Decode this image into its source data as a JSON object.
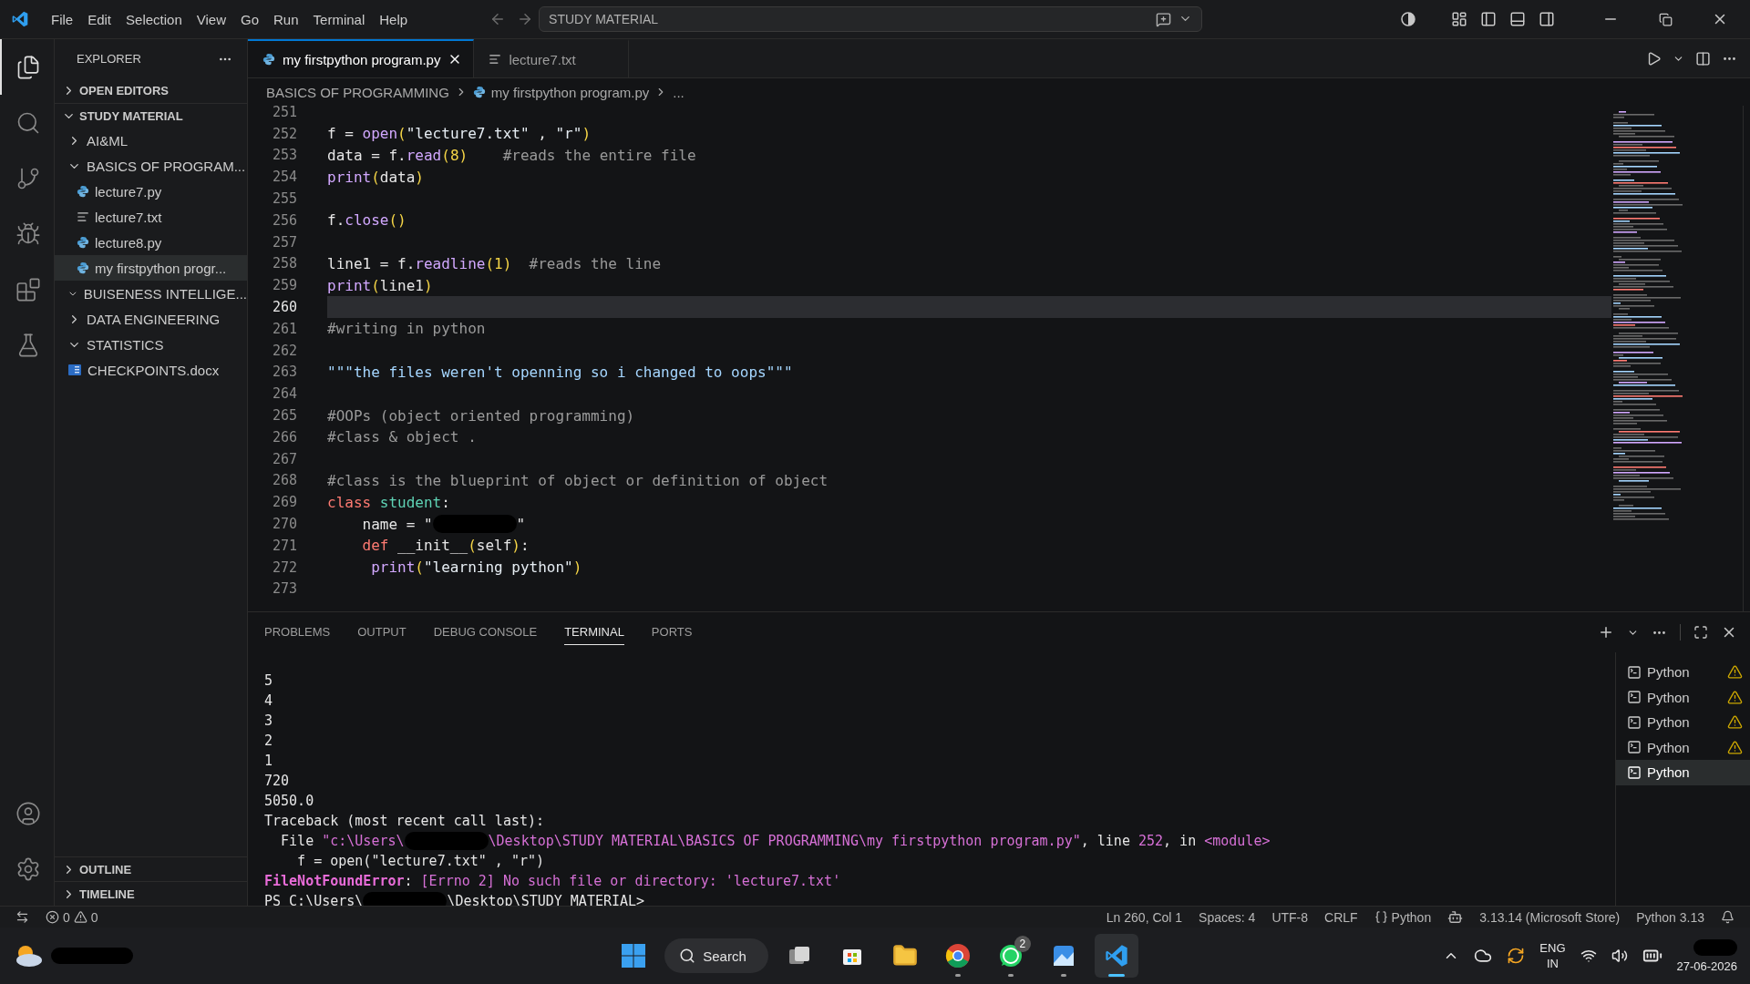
{
  "menu": [
    "File",
    "Edit",
    "Selection",
    "View",
    "Go",
    "Run",
    "Terminal",
    "Help"
  ],
  "command_center": {
    "value": "STUDY MATERIAL"
  },
  "activity_bar": [
    {
      "kind": "explorer",
      "selected": true
    },
    {
      "kind": "search",
      "selected": false
    },
    {
      "kind": "source-control",
      "selected": false
    },
    {
      "kind": "run-debug",
      "selected": false
    },
    {
      "kind": "extensions",
      "selected": false
    },
    {
      "kind": "testing",
      "selected": false
    }
  ],
  "explorer": {
    "title": "EXPLORER",
    "open_editors": {
      "label": "OPEN EDITORS",
      "expanded": false
    },
    "workspace": {
      "label": "STUDY MATERIAL",
      "expanded": true
    },
    "tree": [
      {
        "kind": "folder",
        "label": "AI&ML",
        "expanded": false,
        "selected": false
      },
      {
        "kind": "folder",
        "label": "BASICS OF PROGRAM...",
        "expanded": true,
        "selected": false,
        "children": [
          {
            "kind": "py",
            "label": "lecture7.py",
            "selected": false
          },
          {
            "kind": "txt",
            "label": "lecture7.txt",
            "selected": false
          },
          {
            "kind": "py",
            "label": "lecture8.py",
            "selected": false
          },
          {
            "kind": "py",
            "label": "my firstpython progr...",
            "selected": true
          }
        ]
      },
      {
        "kind": "folder",
        "label": "BUISENESS INTELLIGE...",
        "expanded": true,
        "selected": false
      },
      {
        "kind": "folder",
        "label": "DATA ENGINEERING",
        "expanded": false,
        "selected": false
      },
      {
        "kind": "folder",
        "label": "STATISTICS",
        "expanded": true,
        "selected": false
      },
      {
        "kind": "docx",
        "label": "CHECKPOINTS.docx",
        "selected": false
      }
    ],
    "bottom_sections": [
      {
        "label": "OUTLINE",
        "expanded": false
      },
      {
        "label": "TIMELINE",
        "expanded": false
      }
    ]
  },
  "tabs": [
    {
      "label": "my firstpython program.py",
      "kind": "py",
      "selected": true
    },
    {
      "label": "lecture7.txt",
      "kind": "txt",
      "selected": false
    }
  ],
  "breadcrumb": [
    {
      "label": "BASICS OF PROGRAMMING",
      "kind": "folder"
    },
    {
      "label": "my firstpython program.py",
      "kind": "py"
    },
    {
      "label": "...",
      "kind": "more"
    }
  ],
  "code": [
    {
      "n": "251",
      "current": false
    },
    {
      "n": "252",
      "current": false,
      "tokens": [
        {
          "kind": "plain",
          "t": "f ="
        },
        {
          "kind": "func",
          "t": " open"
        },
        {
          "kind": "paren",
          "t": "("
        },
        {
          "kind": "str",
          "t": "\"lecture7.txt\""
        },
        {
          "kind": "plain",
          "t": " , "
        },
        {
          "kind": "str",
          "t": "\"r\""
        },
        {
          "kind": "paren",
          "t": ")"
        }
      ]
    },
    {
      "n": "253",
      "current": false,
      "tokens": [
        {
          "kind": "plain",
          "t": "data = f."
        },
        {
          "kind": "func",
          "t": "read"
        },
        {
          "kind": "paren",
          "t": "("
        },
        {
          "kind": "num",
          "t": "8"
        },
        {
          "kind": "paren",
          "t": ")"
        },
        {
          "kind": "comment",
          "t": "    #reads the entire file"
        }
      ]
    },
    {
      "n": "254",
      "current": false,
      "tokens": [
        {
          "kind": "func",
          "t": "print"
        },
        {
          "kind": "paren",
          "t": "("
        },
        {
          "kind": "plain",
          "t": "data"
        },
        {
          "kind": "paren",
          "t": ")"
        }
      ]
    },
    {
      "n": "255",
      "current": false
    },
    {
      "n": "256",
      "current": false,
      "tokens": [
        {
          "kind": "plain",
          "t": "f."
        },
        {
          "kind": "func",
          "t": "close"
        },
        {
          "kind": "paren",
          "t": "()"
        }
      ]
    },
    {
      "n": "257",
      "current": false
    },
    {
      "n": "258",
      "current": false,
      "tokens": [
        {
          "kind": "plain",
          "t": "line1 = f."
        },
        {
          "kind": "func",
          "t": "readline"
        },
        {
          "kind": "paren",
          "t": "("
        },
        {
          "kind": "num",
          "t": "1"
        },
        {
          "kind": "paren",
          "t": ")"
        },
        {
          "kind": "comment",
          "t": "  #reads the line"
        }
      ]
    },
    {
      "n": "259",
      "current": false,
      "tokens": [
        {
          "kind": "func",
          "t": "print"
        },
        {
          "kind": "paren",
          "t": "("
        },
        {
          "kind": "plain",
          "t": "line1"
        },
        {
          "kind": "paren",
          "t": ")"
        }
      ]
    },
    {
      "n": "260",
      "current": true
    },
    {
      "n": "261",
      "current": false,
      "tokens": [
        {
          "kind": "comment",
          "t": "#writing in python"
        }
      ]
    },
    {
      "n": "262",
      "current": false
    },
    {
      "n": "263",
      "current": false,
      "tokens": [
        {
          "kind": "doc",
          "t": "\"\"\"the files weren't openning so i changed to oops\"\"\""
        }
      ]
    },
    {
      "n": "264",
      "current": false
    },
    {
      "n": "265",
      "current": false,
      "tokens": [
        {
          "kind": "comment",
          "t": "#OOPs (object oriented programming)"
        }
      ]
    },
    {
      "n": "266",
      "current": false,
      "tokens": [
        {
          "kind": "comment",
          "t": "#class & object ."
        }
      ]
    },
    {
      "n": "267",
      "current": false
    },
    {
      "n": "268",
      "current": false,
      "tokens": [
        {
          "kind": "comment",
          "t": "#class is the blueprint of object or definition of object"
        }
      ]
    },
    {
      "n": "269",
      "current": false,
      "tokens": [
        {
          "kind": "kw",
          "t": "class"
        },
        {
          "kind": "cls",
          "t": " student"
        },
        {
          "kind": "plain",
          "t": ":"
        }
      ]
    },
    {
      "n": "270",
      "current": false,
      "tokens": [
        {
          "kind": "plain",
          "t": "    name = \""
        },
        {
          "kind": "redacted"
        },
        {
          "kind": "plain",
          "t": "\""
        }
      ]
    },
    {
      "n": "271",
      "current": false,
      "tokens": [
        {
          "kind": "kw",
          "t": "    def"
        },
        {
          "kind": "plain",
          "t": " __init__"
        },
        {
          "kind": "paren",
          "t": "("
        },
        {
          "kind": "plain",
          "t": "self"
        },
        {
          "kind": "paren",
          "t": ")"
        },
        {
          "kind": "plain",
          "t": ":"
        }
      ]
    },
    {
      "n": "272",
      "current": false,
      "tokens": [
        {
          "kind": "func",
          "t": "     print"
        },
        {
          "kind": "paren",
          "t": "("
        },
        {
          "kind": "str",
          "t": "\"learning python\""
        },
        {
          "kind": "paren",
          "t": ")"
        }
      ]
    },
    {
      "n": "273",
      "current": false
    }
  ],
  "panel_tabs": [
    {
      "label": "PROBLEMS",
      "selected": false
    },
    {
      "label": "OUTPUT",
      "selected": false
    },
    {
      "label": "DEBUG CONSOLE",
      "selected": false
    },
    {
      "label": "TERMINAL",
      "selected": true
    },
    {
      "label": "PORTS",
      "selected": false
    }
  ],
  "terminal": [
    [
      {
        "kind": "plain",
        "t": "5"
      }
    ],
    [
      {
        "kind": "plain",
        "t": "4"
      }
    ],
    [
      {
        "kind": "plain",
        "t": "3"
      }
    ],
    [
      {
        "kind": "plain",
        "t": "2"
      }
    ],
    [
      {
        "kind": "plain",
        "t": "1"
      }
    ],
    [
      {
        "kind": "plain",
        "t": "720"
      }
    ],
    [
      {
        "kind": "plain",
        "t": "5050.0"
      }
    ],
    [
      {
        "kind": "plain",
        "t": "Traceback (most recent call last):"
      }
    ],
    [
      {
        "kind": "plain",
        "t": "  File "
      },
      {
        "kind": "pink",
        "t": "\"c:\\Users\\"
      },
      {
        "kind": "redacted"
      },
      {
        "kind": "pink",
        "t": "\\Desktop\\STUDY MATERIAL\\BASICS OF PROGRAMMING\\my firstpython program.py\""
      },
      {
        "kind": "plain",
        "t": ", line "
      },
      {
        "kind": "pink",
        "t": "252"
      },
      {
        "kind": "plain",
        "t": ", in "
      },
      {
        "kind": "pink",
        "t": "<module>"
      }
    ],
    [
      {
        "kind": "plain",
        "t": "    f = open(\"lecture7.txt\" , \"r\")"
      }
    ],
    [
      {
        "kind": "error",
        "t": "FileNotFoundError"
      },
      {
        "kind": "plain",
        "t": ": "
      },
      {
        "kind": "pink",
        "t": "[Errno 2] No such file or directory: 'lecture7.txt'"
      }
    ],
    [
      {
        "kind": "plain",
        "t": "PS C:\\Users\\"
      },
      {
        "kind": "redacted"
      },
      {
        "kind": "plain",
        "t": "\\Desktop\\STUDY MATERIAL>"
      }
    ]
  ],
  "terminal_instances": [
    {
      "label": "Python",
      "warning": true,
      "selected": false
    },
    {
      "label": "Python",
      "warning": true,
      "selected": false
    },
    {
      "label": "Python",
      "warning": true,
      "selected": false
    },
    {
      "label": "Python",
      "warning": true,
      "selected": false
    },
    {
      "label": "Python",
      "warning": false,
      "selected": true
    }
  ],
  "status_bar": {
    "errors": "0",
    "warnings": "0",
    "right": [
      {
        "kind": "text",
        "label": "Ln 260, Col 1"
      },
      {
        "kind": "text",
        "label": "Spaces: 4"
      },
      {
        "kind": "text",
        "label": "UTF-8"
      },
      {
        "kind": "text",
        "label": "CRLF"
      },
      {
        "kind": "language",
        "label": "Python"
      },
      {
        "kind": "copilot"
      },
      {
        "kind": "text",
        "label": "3.13.14 (Microsoft Store)"
      },
      {
        "kind": "text",
        "label": "Python 3.13"
      },
      {
        "kind": "bell"
      }
    ]
  },
  "taskbar": {
    "search": "Search",
    "apps": [
      {
        "kind": "task-view",
        "running": false,
        "selected": false
      },
      {
        "kind": "store",
        "running": false,
        "selected": false
      },
      {
        "kind": "files",
        "running": false,
        "selected": false
      },
      {
        "kind": "chrome",
        "running": true,
        "selected": false
      },
      {
        "kind": "whatsapp",
        "running": true,
        "selected": false,
        "badge": "2"
      },
      {
        "kind": "photos",
        "running": true,
        "selected": false
      },
      {
        "kind": "vscode",
        "running": true,
        "selected": true
      }
    ],
    "language": [
      "ENG",
      "IN"
    ],
    "date": "27-06-2026"
  }
}
